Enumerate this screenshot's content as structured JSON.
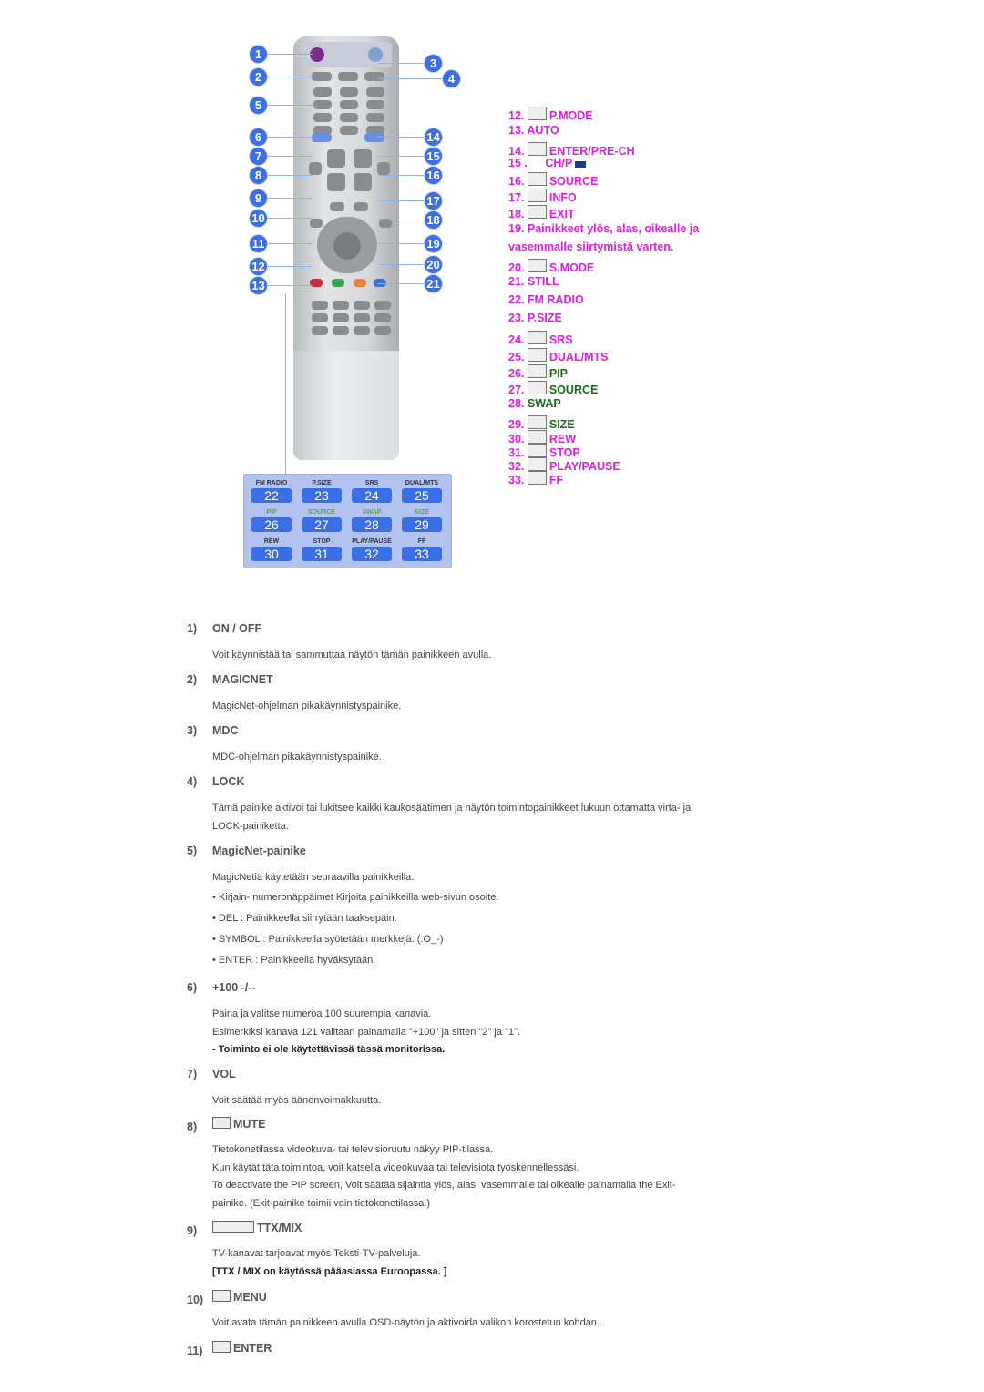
{
  "callouts_left": [
    "1",
    "2",
    "5",
    "6",
    "7",
    "8",
    "9",
    "10",
    "11",
    "12",
    "13"
  ],
  "callouts_right": [
    "3",
    "4",
    "14",
    "15",
    "16",
    "17",
    "18",
    "19",
    "20",
    "21"
  ],
  "panel": {
    "rows": [
      [
        {
          "label": "FM RADIO",
          "num": "22"
        },
        {
          "label": "P.SIZE",
          "num": "23"
        },
        {
          "label": "SRS",
          "num": "24"
        },
        {
          "label": "DUAL/MTS",
          "num": "25"
        }
      ],
      [
        {
          "label": "PIP",
          "num": "26",
          "green": true
        },
        {
          "label": "SOURCE",
          "num": "27",
          "green": true
        },
        {
          "label": "SWAP",
          "num": "28",
          "green": true
        },
        {
          "label": "SIZE",
          "num": "29",
          "green": true
        }
      ],
      [
        {
          "label": "REW",
          "num": "30"
        },
        {
          "label": "STOP",
          "num": "31"
        },
        {
          "label": "PLAY/PAUSE",
          "num": "32"
        },
        {
          "label": "FF",
          "num": "33"
        }
      ]
    ]
  },
  "colors": {
    "accent": "#e020e0",
    "green": "#1a6e1a",
    "callout": "#3d6fe0"
  },
  "right_list": [
    {
      "num": "12.",
      "icon": "mb-icon",
      "label": "P.MODE"
    },
    {
      "num": "13.",
      "label": "AUTO"
    },
    {
      "num": "14.",
      "icon": "enter-prech-icon",
      "label": "ENTER/PRE-CH"
    },
    {
      "num": "15 .",
      "label": "CH/P",
      "icon_after": "chp-icon"
    },
    {
      "num": "16.",
      "icon": "source-icon",
      "label": "SOURCE"
    },
    {
      "num": "17.",
      "icon": "info-icon",
      "label": "INFO"
    },
    {
      "num": "18.",
      "icon": "exit-icon",
      "label": "EXIT"
    },
    {
      "num": "19.",
      "label": "Painikkeet ylös, alas, oikealle ja"
    },
    {
      "num": "",
      "label": "vasemmalle siirtymistä varten."
    },
    {
      "num": "20.",
      "icon": "smode-icon",
      "label": "S.MODE"
    },
    {
      "num": "21.",
      "label": "STILL"
    },
    {
      "num": "22.",
      "label": "FM RADIO"
    },
    {
      "num": "23.",
      "label": "P.SIZE"
    },
    {
      "num": "24.",
      "icon": "srs-icon",
      "label": "SRS"
    },
    {
      "num": "25.",
      "icon": "dual-icon",
      "label": "DUAL/MTS"
    },
    {
      "num": "26.",
      "icon": "pip-icon",
      "label": "PIP",
      "green": true
    },
    {
      "num": "27.",
      "icon": "source-icon",
      "label": "SOURCE",
      "green": true
    },
    {
      "num": "28.",
      "label": "SWAP",
      "green": true
    },
    {
      "num": "29.",
      "icon": "size-icon",
      "label": "SIZE",
      "green": true
    },
    {
      "num": "30.",
      "icon": "rew-icon",
      "label": "REW"
    },
    {
      "num": "31.",
      "icon": "stop-icon",
      "label": "STOP"
    },
    {
      "num": "32.",
      "icon": "play-pause-icon",
      "label": "PLAY/PAUSE"
    },
    {
      "num": "33.",
      "icon": "ff-icon",
      "label": "FF"
    }
  ],
  "sections": [
    {
      "num": "1)",
      "title": "ON / OFF",
      "paras": [
        "Voit käynnistää tai sammuttaa näytön tämän painikkeen avulla."
      ]
    },
    {
      "num": "2)",
      "title": "MAGICNET",
      "paras": [
        "MagicNet-ohjelman pikakäynnistyspainike."
      ]
    },
    {
      "num": "3)",
      "title": "MDC",
      "paras": [
        "MDC-ohjelman pikakäynnistyspainike."
      ]
    },
    {
      "num": "4)",
      "title": "LOCK",
      "paras": [
        "Tämä painike aktivoi tai lukitsee kaikki kaukosäätimen ja näytön toimintopainikkeet lukuun ottamatta virta- ja",
        "LOCK-painiketta."
      ]
    },
    {
      "num": "5)",
      "title": "MagicNet-painike",
      "paras": [
        "MagicNetiä käytetään seuraavilla painikkeilla."
      ],
      "bullets": [
        "• Kirjain- numeronäppäimet Kirjoita painikkeilla web-sivun osoite.",
        "• DEL : Painikkeella siirrytään taaksepäin.",
        "• SYMBOL : Painikkeella syötetään merkkejä. (.O_-)",
        "• ENTER : Painikkeella hyväksytään."
      ]
    },
    {
      "num": "6)",
      "title": "+100 -/--",
      "paras": [
        "Paina ja valitse numeroa 100 suurempia kanavia.",
        "Esimerkiksi kanava 121 valitaan painamalla \"+100\" ja sitten \"2\" ja \"1\"."
      ],
      "bold": "- Toiminto ei ole käytettävissä tässä monitorissa."
    },
    {
      "num": "7)",
      "title": "VOL",
      "paras": [
        "Voit säätää myös äänenvoimakkuutta."
      ]
    },
    {
      "num": "8)",
      "title": "MUTE",
      "icon": "mute-icon",
      "paras": [
        "Tietokonetilassa videokuva- tai televisioruutu näkyy PIP-tilassa.",
        "Kun käytät täta toimintoa, voit katsella videokuvaa tai televisiota työskennellessäsi.",
        "To deactivate the PIP screen, Voit säätää sijaintia ylös, alas, vasemmalle tai oikealle painamalla the Exit-",
        "painike. (Exit-painike toimii vain tietokonetilassa.)"
      ]
    },
    {
      "num": "9)",
      "title": "TTX/MIX",
      "icon": "ttx-mix-icon",
      "paras": [
        "TV-kanavat tarjoavat myös Teksti-TV-palveluja."
      ],
      "bold": "[TTX / MIX on käytössä pääasiassa Euroopassa. ]"
    },
    {
      "num": "10)",
      "title": "MENU",
      "icon": "menu-icon",
      "paras": [
        "Voit avata tämän painikkeen avulla OSD-näytön ja aktivoida valikon korostetun kohdan."
      ]
    },
    {
      "num": "11)",
      "title": "ENTER",
      "icon": "enter-icon",
      "paras": []
    }
  ]
}
